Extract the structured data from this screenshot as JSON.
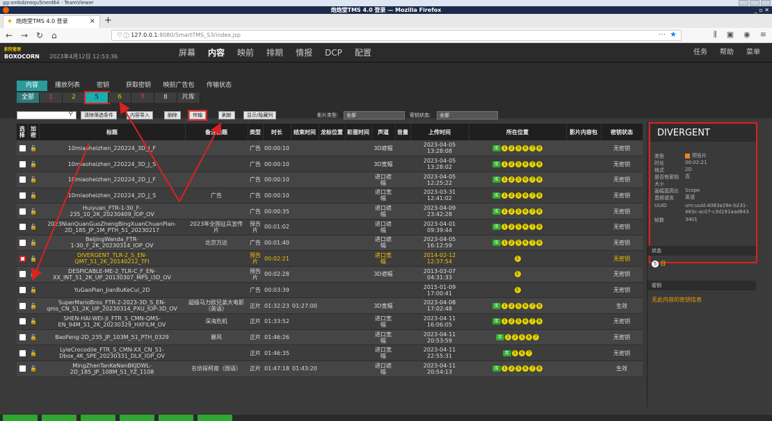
{
  "teamviewer": {
    "title": "gg-smbdznequ5nerd64 - TeamViewer"
  },
  "browser": {
    "window_title": "炮炮堂TMS 4.0 登录 — Mozilla Firefox",
    "tab_label": "炮炮堂TMS 4.0 登录",
    "url_host": "127.0.0.1",
    "url_rest": ":8080/SmartTMS_S3/index.jsp",
    "menu_dots": "···"
  },
  "app": {
    "logo_top": "影院管理",
    "logo_bottom": "BOXOCORN",
    "clock": "2023年4月12日 12:53:36",
    "main_menu": [
      "屏幕",
      "内容",
      "映前",
      "排期",
      "情报",
      "DCP",
      "配置"
    ],
    "active_menu": "内容",
    "right_menu": [
      "任务",
      "帮助",
      "菜单"
    ],
    "sub_tabs": [
      "内容",
      "播放列表",
      "密钥",
      "获取密钥",
      "映前广告包",
      "传输状态"
    ],
    "num_tabs": [
      "全部",
      "1",
      "2",
      "5",
      "6",
      "7",
      "8",
      "片库"
    ]
  },
  "toolbar": {
    "buttons": [
      "清除筛选条件",
      "内容导入",
      "删除",
      "传输",
      "刷新",
      "显示/隐藏列"
    ],
    "type_label": "影片类型:",
    "type_value": "全部",
    "key_label": "密钥状态:",
    "key_value": "全部"
  },
  "table": {
    "headers": [
      "选择",
      "加密",
      "标题",
      "备注标题",
      "类型",
      "时长",
      "结束时间",
      "龙标位置",
      "彩蛋时间",
      "声道",
      "音量",
      "上传时间",
      "所在位置",
      "影片内容包",
      "密钥状态"
    ],
    "rows": [
      {
        "title": "10miaoheizhen_220224_3D_J_F",
        "note": "",
        "type": "广告",
        "dur": "00:00:10",
        "end": "",
        "ch": "3D遮幅",
        "up": "2023-04-05\n13:28:08",
        "pos": [
          "1",
          "2",
          "5",
          "6",
          "7",
          "8"
        ],
        "key": "无密钥",
        "sel": false
      },
      {
        "title": "10miaoheizhen_220224_3D_J_S",
        "note": "",
        "type": "广告",
        "dur": "00:00:10",
        "end": "",
        "ch": "3D宽幅",
        "up": "2023-04-05\n13:28:02",
        "pos": [
          "1",
          "2",
          "5",
          "6",
          "7",
          "8"
        ],
        "key": "无密钥",
        "sel": false
      },
      {
        "title": "10miaoheizhen_220224_2D_J_F",
        "note": "",
        "type": "广告",
        "dur": "00:00:10",
        "end": "",
        "ch": "进口遮\n幅",
        "up": "2023-04-05\n12:25:22",
        "pos": [
          "1",
          "2",
          "5",
          "6",
          "7",
          "8"
        ],
        "key": "无密钥",
        "sel": false
      },
      {
        "title": "10miaoheizhen_220224_2D_J_S",
        "note": "广告",
        "type": "广告",
        "dur": "00:00:10",
        "end": "",
        "ch": "进口宽\n幅",
        "up": "2023-03-31\n12:41:02",
        "pos": [
          "1",
          "2",
          "5",
          "6",
          "7",
          "8"
        ],
        "key": "无密钥",
        "sel": false
      },
      {
        "title": "Huiyuan_FTR-1-30_F-\n235_10_2K_20230409_IOP_OV",
        "note": "",
        "type": "广告",
        "dur": "00:00:35",
        "end": "",
        "ch": "进口遮\n幅",
        "up": "2023-04-09\n23:42:28",
        "pos": [
          "1",
          "2",
          "5",
          "6",
          "7",
          "8"
        ],
        "key": "无密钥",
        "sel": false
      },
      {
        "title": "2023NianQuanGuoZhengBingXuanChuanPian-\n2D_185_JP_1M_PTH_51_20230217",
        "note": "2023年全国征兵宣传\n片",
        "type": "预告片",
        "dur": "00:01:02",
        "end": "",
        "ch": "进口遮\n幅",
        "up": "2023-04-01\n09:39:44",
        "pos": [
          "1",
          "2",
          "5",
          "6",
          "7",
          "8"
        ],
        "key": "无密钥",
        "sel": false
      },
      {
        "title": "BeijingWanda_FTR-\n1-30_F_2K_20230314_IOP_OV",
        "note": "北京万达",
        "type": "广告",
        "dur": "00:01:40",
        "end": "",
        "ch": "进口遮\n幅",
        "up": "2023-04-05\n16:12:59",
        "pos": [
          "1",
          "2",
          "5",
          "6",
          "7",
          "8"
        ],
        "key": "无密钥",
        "sel": false
      },
      {
        "title": "DIVERGENT_TLR-2_S_EN-\nQMT_51_2K_20140212_TFI",
        "note": "",
        "type": "预告片",
        "dur": "00:02:21",
        "end": "",
        "ch": "进口宽\n幅",
        "up": "2014-02-12\n12:37:54",
        "pos": [
          "5"
        ],
        "key": "无密钥",
        "sel": true
      },
      {
        "title": "DESPICABLE-ME-2_TLR-C_F_EN-\nXX_INT_51_2K_UP_20130307_MPS_i3D_OV",
        "note": "",
        "type": "预告片",
        "dur": "00:02:28",
        "end": "",
        "ch": "3D遮幅",
        "up": "2013-03-07\n04:31:33",
        "pos": [
          "5"
        ],
        "key": "无密钥",
        "sel": false
      },
      {
        "title": "YuGaoPian_JianBuKeCui_2D",
        "note": "",
        "type": "广告",
        "dur": "00:03:39",
        "end": "",
        "ch": "",
        "up": "2015-01-09\n17:00:41",
        "pos": [
          "5"
        ],
        "key": "无密钥",
        "sel": false
      },
      {
        "title": "SuperMarioBros_FTR-2-2023-3D_S_EN-\nqms_CN_51_2K_UP_20230314_PXU_IOP-3D_OV",
        "note": "超级马力欧兄弟大电影\n（英语）",
        "type": "正片",
        "dur": "01:32:23",
        "end": "01:27:00",
        "ch": "3D宽幅",
        "up": "2023-04-08\n17:02:48",
        "pos": [
          "1",
          "2",
          "5",
          "6",
          "7",
          "8"
        ],
        "key": "生效",
        "sel": false
      },
      {
        "title": "SHEN-HAI-WEI-JI_FTR_S_CMN-QMS-\nEN_94M_51_2K_20230329_HXFILM_OV",
        "note": "深海危机",
        "type": "正片",
        "dur": "01:33:52",
        "end": "",
        "ch": "进口宽\n幅",
        "up": "2023-04-11\n16:06:05",
        "pos": [
          "1",
          "2",
          "5",
          "6",
          "7",
          "8"
        ],
        "key": "无密钥",
        "sel": false
      },
      {
        "title": "BaoFeng-2D_235_JP_103M_51_PTH_0329",
        "note": "暴风",
        "type": "正片",
        "dur": "01:46:26",
        "end": "",
        "ch": "进口宽\n幅",
        "up": "2023-04-11\n20:53:59",
        "pos": [
          "1",
          "2",
          "5",
          "6",
          "7"
        ],
        "key": "无密钥",
        "sel": false
      },
      {
        "title": "LyleCrocodile_FTR_S_CMN-XX_CN_51-\nDbox_4K_SPE_20230331_DLX_IOP_OV",
        "note": "",
        "type": "正片",
        "dur": "01:46:35",
        "end": "",
        "ch": "进口宽\n幅",
        "up": "2023-04-11\n22:55:31",
        "pos": [
          "5",
          "6",
          "7"
        ],
        "key": "无密钥",
        "sel": false
      },
      {
        "title": "MingZhenTanKeNanBKJDWL-\n2D_185_JP_108M_51_YZ_1108",
        "note": "名侦探柯南（国语）",
        "type": "正片",
        "dur": "01:47:18",
        "end": "01:43:20",
        "ch": "进口遮\n幅",
        "up": "2023-04-11\n20:54:13",
        "pos": [
          "1",
          "2",
          "5",
          "6",
          "7",
          "8"
        ],
        "key": "生效",
        "sel": false
      }
    ]
  },
  "panel": {
    "title": "DIVERGENT",
    "fields": [
      {
        "k": "类型",
        "v": "预告片"
      },
      {
        "k": "时长",
        "v": "00:02:21"
      },
      {
        "k": "格式",
        "v": "2D"
      },
      {
        "k": "是否有密钥",
        "v": "否"
      },
      {
        "k": "大小",
        "v": ""
      },
      {
        "k": "画幅宽高比",
        "v": "Scope"
      },
      {
        "k": "音频语言",
        "v": "英语"
      },
      {
        "k": "UUID",
        "v": "urn:uuid:4083a29e-b231-463c-ac07-c3d191aad843"
      },
      {
        "k": "帧数",
        "v": "3401"
      }
    ],
    "status_label": "状态",
    "status_value": "5",
    "status_text": "日",
    "key_label": "密钥",
    "key_info": "无此内容的密钥信息"
  },
  "colors": {
    "accent": "#2a9c9c",
    "highlight": "#e02020",
    "selected_text": "#f2c400",
    "dot": "#e7d400",
    "green": "#2ea82e"
  }
}
